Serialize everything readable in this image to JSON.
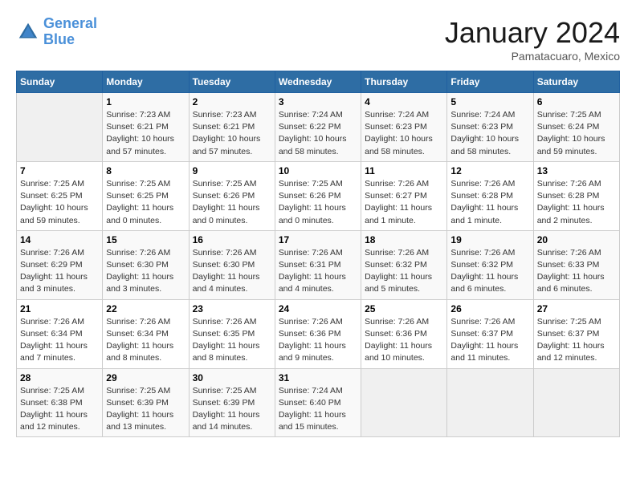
{
  "header": {
    "logo_line1": "General",
    "logo_line2": "Blue",
    "month": "January 2024",
    "location": "Pamatacuaro, Mexico"
  },
  "weekdays": [
    "Sunday",
    "Monday",
    "Tuesday",
    "Wednesday",
    "Thursday",
    "Friday",
    "Saturday"
  ],
  "weeks": [
    [
      {
        "day": "",
        "info": ""
      },
      {
        "day": "1",
        "info": "Sunrise: 7:23 AM\nSunset: 6:21 PM\nDaylight: 10 hours and 57 minutes."
      },
      {
        "day": "2",
        "info": "Sunrise: 7:23 AM\nSunset: 6:21 PM\nDaylight: 10 hours and 57 minutes."
      },
      {
        "day": "3",
        "info": "Sunrise: 7:24 AM\nSunset: 6:22 PM\nDaylight: 10 hours and 58 minutes."
      },
      {
        "day": "4",
        "info": "Sunrise: 7:24 AM\nSunset: 6:23 PM\nDaylight: 10 hours and 58 minutes."
      },
      {
        "day": "5",
        "info": "Sunrise: 7:24 AM\nSunset: 6:23 PM\nDaylight: 10 hours and 58 minutes."
      },
      {
        "day": "6",
        "info": "Sunrise: 7:25 AM\nSunset: 6:24 PM\nDaylight: 10 hours and 59 minutes."
      }
    ],
    [
      {
        "day": "7",
        "info": "Sunrise: 7:25 AM\nSunset: 6:25 PM\nDaylight: 10 hours and 59 minutes."
      },
      {
        "day": "8",
        "info": "Sunrise: 7:25 AM\nSunset: 6:25 PM\nDaylight: 11 hours and 0 minutes."
      },
      {
        "day": "9",
        "info": "Sunrise: 7:25 AM\nSunset: 6:26 PM\nDaylight: 11 hours and 0 minutes."
      },
      {
        "day": "10",
        "info": "Sunrise: 7:25 AM\nSunset: 6:26 PM\nDaylight: 11 hours and 0 minutes."
      },
      {
        "day": "11",
        "info": "Sunrise: 7:26 AM\nSunset: 6:27 PM\nDaylight: 11 hours and 1 minute."
      },
      {
        "day": "12",
        "info": "Sunrise: 7:26 AM\nSunset: 6:28 PM\nDaylight: 11 hours and 1 minute."
      },
      {
        "day": "13",
        "info": "Sunrise: 7:26 AM\nSunset: 6:28 PM\nDaylight: 11 hours and 2 minutes."
      }
    ],
    [
      {
        "day": "14",
        "info": "Sunrise: 7:26 AM\nSunset: 6:29 PM\nDaylight: 11 hours and 3 minutes."
      },
      {
        "day": "15",
        "info": "Sunrise: 7:26 AM\nSunset: 6:30 PM\nDaylight: 11 hours and 3 minutes."
      },
      {
        "day": "16",
        "info": "Sunrise: 7:26 AM\nSunset: 6:30 PM\nDaylight: 11 hours and 4 minutes."
      },
      {
        "day": "17",
        "info": "Sunrise: 7:26 AM\nSunset: 6:31 PM\nDaylight: 11 hours and 4 minutes."
      },
      {
        "day": "18",
        "info": "Sunrise: 7:26 AM\nSunset: 6:32 PM\nDaylight: 11 hours and 5 minutes."
      },
      {
        "day": "19",
        "info": "Sunrise: 7:26 AM\nSunset: 6:32 PM\nDaylight: 11 hours and 6 minutes."
      },
      {
        "day": "20",
        "info": "Sunrise: 7:26 AM\nSunset: 6:33 PM\nDaylight: 11 hours and 6 minutes."
      }
    ],
    [
      {
        "day": "21",
        "info": "Sunrise: 7:26 AM\nSunset: 6:34 PM\nDaylight: 11 hours and 7 minutes."
      },
      {
        "day": "22",
        "info": "Sunrise: 7:26 AM\nSunset: 6:34 PM\nDaylight: 11 hours and 8 minutes."
      },
      {
        "day": "23",
        "info": "Sunrise: 7:26 AM\nSunset: 6:35 PM\nDaylight: 11 hours and 8 minutes."
      },
      {
        "day": "24",
        "info": "Sunrise: 7:26 AM\nSunset: 6:36 PM\nDaylight: 11 hours and 9 minutes."
      },
      {
        "day": "25",
        "info": "Sunrise: 7:26 AM\nSunset: 6:36 PM\nDaylight: 11 hours and 10 minutes."
      },
      {
        "day": "26",
        "info": "Sunrise: 7:26 AM\nSunset: 6:37 PM\nDaylight: 11 hours and 11 minutes."
      },
      {
        "day": "27",
        "info": "Sunrise: 7:25 AM\nSunset: 6:37 PM\nDaylight: 11 hours and 12 minutes."
      }
    ],
    [
      {
        "day": "28",
        "info": "Sunrise: 7:25 AM\nSunset: 6:38 PM\nDaylight: 11 hours and 12 minutes."
      },
      {
        "day": "29",
        "info": "Sunrise: 7:25 AM\nSunset: 6:39 PM\nDaylight: 11 hours and 13 minutes."
      },
      {
        "day": "30",
        "info": "Sunrise: 7:25 AM\nSunset: 6:39 PM\nDaylight: 11 hours and 14 minutes."
      },
      {
        "day": "31",
        "info": "Sunrise: 7:24 AM\nSunset: 6:40 PM\nDaylight: 11 hours and 15 minutes."
      },
      {
        "day": "",
        "info": ""
      },
      {
        "day": "",
        "info": ""
      },
      {
        "day": "",
        "info": ""
      }
    ]
  ]
}
